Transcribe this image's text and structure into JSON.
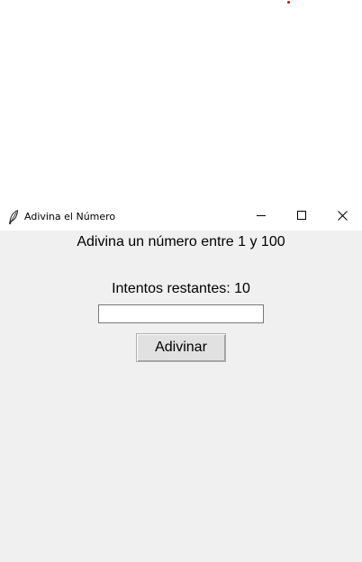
{
  "window": {
    "title": "Adivina el Número",
    "app_icon": "feather-icon",
    "controls": {
      "minimize": "minimize-icon",
      "maximize": "maximize-icon",
      "close": "close-icon"
    }
  },
  "game": {
    "prompt": "Adivina un número entre 1 y 100",
    "attempts_label": "Intentos restantes: 10",
    "guess_input": {
      "value": "",
      "placeholder": ""
    },
    "guess_button_label": "Adivinar"
  },
  "colors": {
    "window_background": "#f0f0f0",
    "titlebar_background": "#ffffff",
    "stray_dot": "#d40000"
  }
}
